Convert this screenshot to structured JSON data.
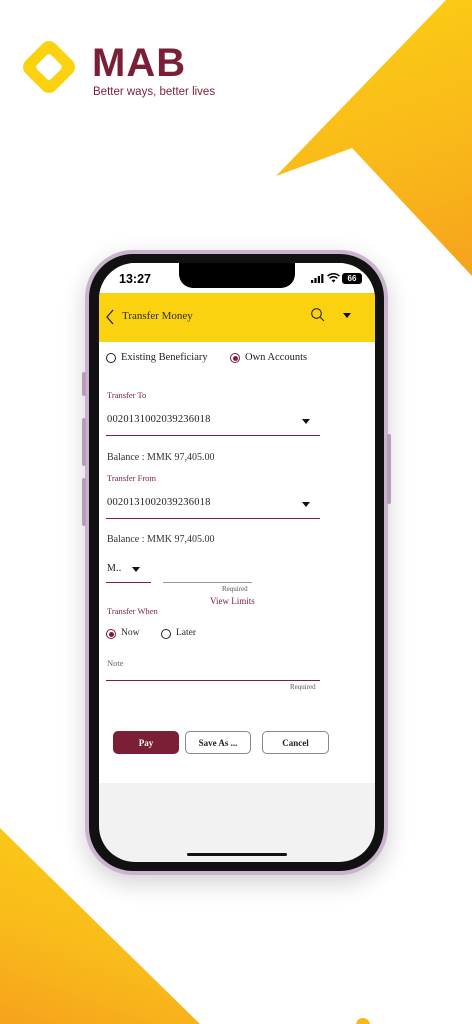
{
  "brand": {
    "name": "MAB",
    "tagline": "Better ways, better lives",
    "colors": {
      "primary": "#7a1f36",
      "accent": "#fbd20f"
    }
  },
  "status_bar": {
    "time": "13:27",
    "battery": "66"
  },
  "app_bar": {
    "title": "Transfer Money",
    "icons": [
      "back-chevron-icon",
      "search-icon",
      "dropdown-caret-icon"
    ]
  },
  "form": {
    "beneficiary_options": [
      {
        "label": "Existing Beneficiary",
        "selected": false
      },
      {
        "label": "Own Accounts",
        "selected": true
      }
    ],
    "transfer_to": {
      "label": "Transfer To",
      "value": "0020131002039236018",
      "balance": "Balance : MMK 97,405.00"
    },
    "transfer_from": {
      "label": "Transfer From",
      "value": "0020131002039236018",
      "balance": "Balance : MMK 97,405.00"
    },
    "currency": {
      "value": "M.."
    },
    "amount": {
      "required_hint": "Required",
      "view_limits": "View Limits"
    },
    "transfer_when": {
      "label": "Transfer When",
      "options": [
        {
          "label": "Now",
          "selected": true
        },
        {
          "label": "Later",
          "selected": false
        }
      ]
    },
    "note": {
      "placeholder": "Note",
      "required_hint": "Required"
    }
  },
  "actions": {
    "pay": "Pay",
    "save_as": "Save As ...",
    "cancel": "Cancel"
  }
}
